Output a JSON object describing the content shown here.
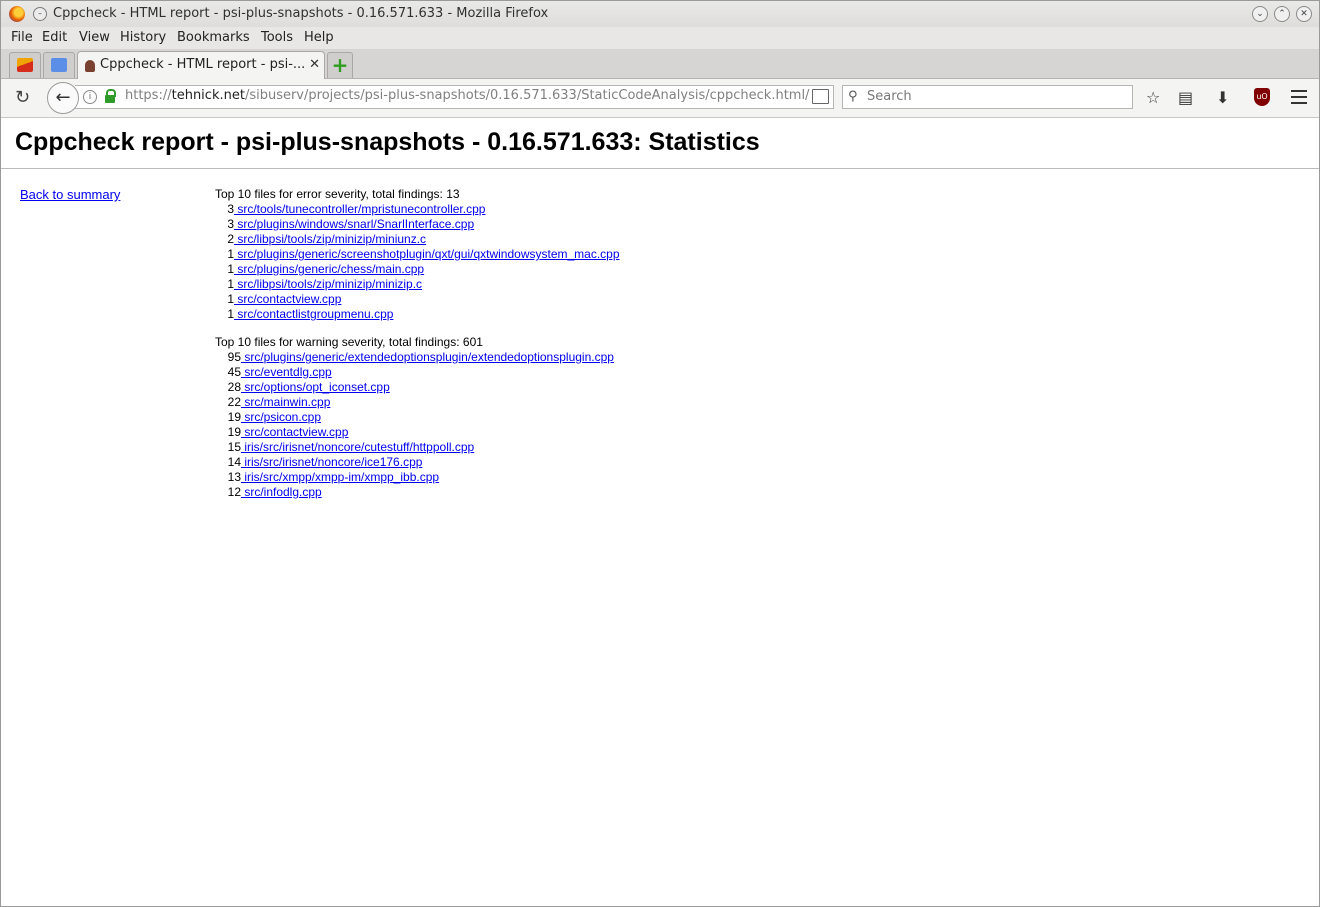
{
  "window": {
    "title": "Cppcheck - HTML report - psi-plus-snapshots - 0.16.571.633 - Mozilla Firefox"
  },
  "menu": [
    "File",
    "Edit",
    "View",
    "History",
    "Bookmarks",
    "Tools",
    "Help"
  ],
  "tabs": {
    "active_label": "Cppcheck - HTML report - psi-...",
    "close": "✕",
    "new": "+"
  },
  "nav": {
    "url_prefix": "https://",
    "url_host": "tehnick.net",
    "url_path": "/sibuserv/projects/psi-plus-snapshots/0.16.571.633/StaticCodeAnalysis/cppcheck.html/",
    "search_placeholder": "Search"
  },
  "page": {
    "title": "Cppcheck report - psi-plus-snapshots - 0.16.571.633: Statistics",
    "back_link": "Back to summary",
    "error_section": {
      "heading": "Top 10 files for error severity, total findings: 13",
      "rows": [
        {
          "count": "3",
          "file": " src/tools/tunecontroller/mpristunecontroller.cpp"
        },
        {
          "count": "3",
          "file": " src/plugins/windows/snarl/SnarlInterface.cpp"
        },
        {
          "count": "2",
          "file": " src/libpsi/tools/zip/minizip/miniunz.c"
        },
        {
          "count": "1",
          "file": " src/plugins/generic/screenshotplugin/qxt/gui/qxtwindowsystem_mac.cpp"
        },
        {
          "count": "1",
          "file": " src/plugins/generic/chess/main.cpp"
        },
        {
          "count": "1",
          "file": " src/libpsi/tools/zip/minizip/minizip.c"
        },
        {
          "count": "1",
          "file": " src/contactview.cpp"
        },
        {
          "count": "1",
          "file": " src/contactlistgroupmenu.cpp"
        }
      ]
    },
    "warning_section": {
      "heading": "Top 10 files for warning severity, total findings: 601",
      "rows": [
        {
          "count": "95",
          "file": " src/plugins/generic/extendedoptionsplugin/extendedoptionsplugin.cpp"
        },
        {
          "count": "45",
          "file": " src/eventdlg.cpp"
        },
        {
          "count": "28",
          "file": " src/options/opt_iconset.cpp"
        },
        {
          "count": "22",
          "file": " src/mainwin.cpp"
        },
        {
          "count": "19",
          "file": " src/psicon.cpp"
        },
        {
          "count": "19",
          "file": " src/contactview.cpp"
        },
        {
          "count": "15",
          "file": " iris/src/irisnet/noncore/cutestuff/httppoll.cpp"
        },
        {
          "count": "14",
          "file": " iris/src/irisnet/noncore/ice176.cpp"
        },
        {
          "count": "13",
          "file": " iris/src/xmpp/xmpp-im/xmpp_ibb.cpp"
        },
        {
          "count": "12",
          "file": " src/infodlg.cpp"
        }
      ]
    }
  }
}
